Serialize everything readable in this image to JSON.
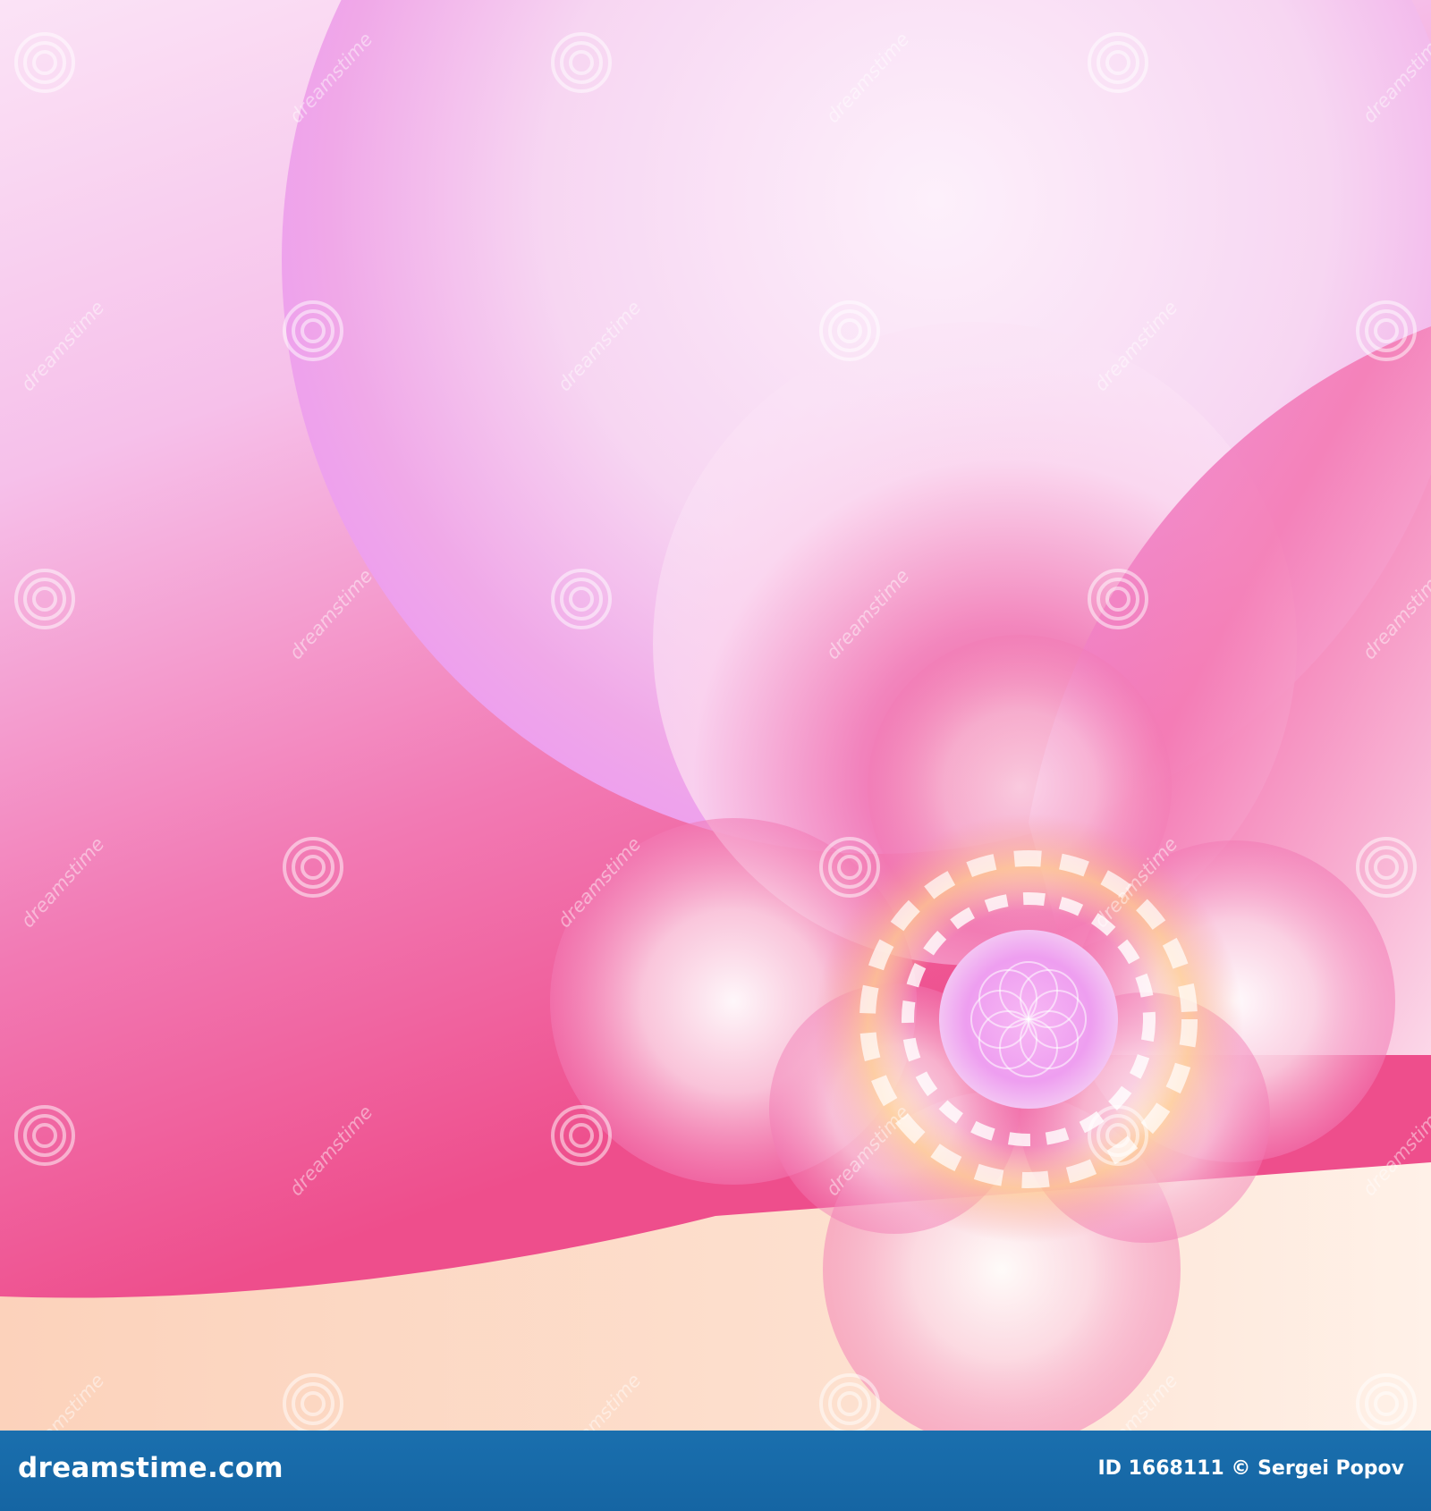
{
  "image": {
    "subject": "abstract-pink-fractal-flower",
    "colors": {
      "hot_pink": "#ee4e8c",
      "pink": "#f27ab4",
      "lilac": "#ec9cf0",
      "pale_pink": "#fbe3f6",
      "peach": "#fcd2bb",
      "cream_center": "#ffe7a8",
      "white": "#ffffff"
    },
    "watermark": {
      "text": "dreamstime",
      "icon": "spiral-icon"
    }
  },
  "footer": {
    "brand": "dreamstime.com",
    "credit": "ID 1668111 © Sergei Popov",
    "color": "#1668a8"
  }
}
